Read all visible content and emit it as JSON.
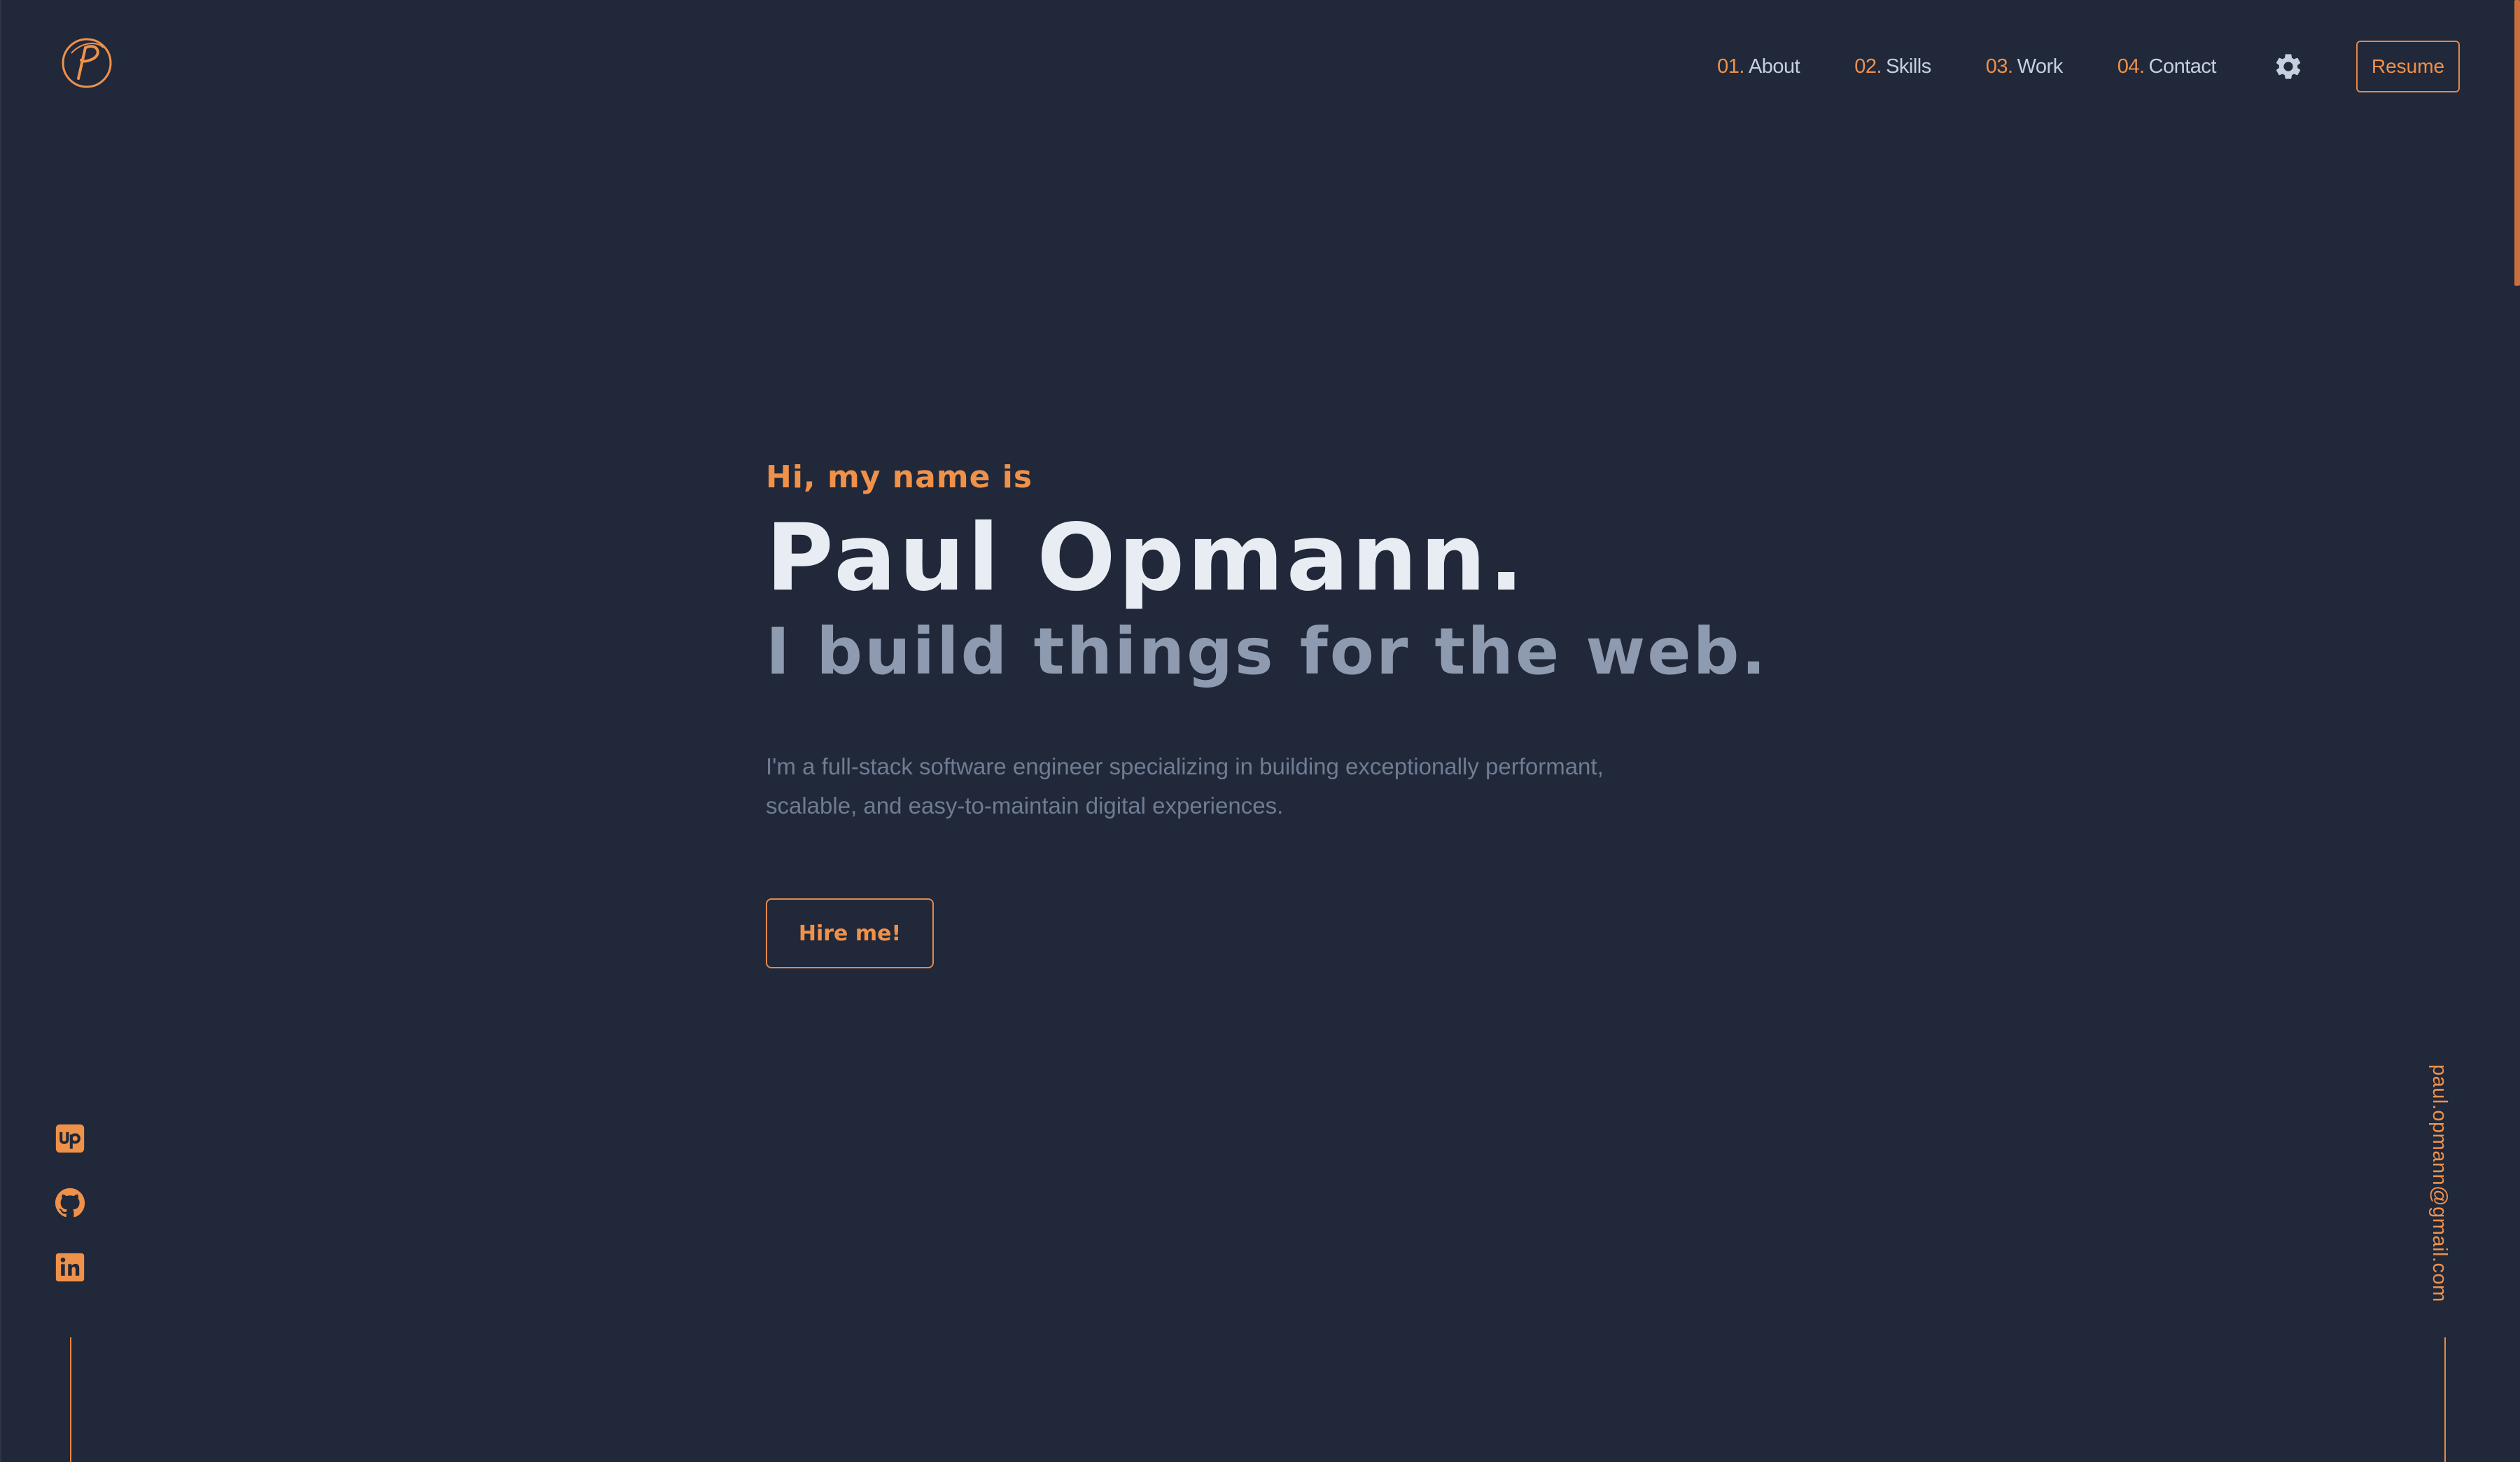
{
  "header": {
    "logo_icon": "p-monogram-logo",
    "nav": [
      {
        "num": "01.",
        "label": "About"
      },
      {
        "num": "02.",
        "label": "Skills"
      },
      {
        "num": "03.",
        "label": "Work"
      },
      {
        "num": "04.",
        "label": "Contact"
      }
    ],
    "theme_icon": "gear-icon",
    "resume_label": "Resume"
  },
  "hero": {
    "greeting": "Hi, my name is",
    "name": "Paul Opmann.",
    "tagline": "I build things for the web.",
    "intro": "I'm a full-stack software engineer specializing in building exceptionally performant, scalable, and easy-to-maintain digital experiences.",
    "cta_label": "Hire me!"
  },
  "social": [
    {
      "icon": "upwork-icon"
    },
    {
      "icon": "github-icon"
    },
    {
      "icon": "linkedin-icon"
    }
  ],
  "email": "paul.opmann@gmail.com",
  "colors": {
    "background": "#202839",
    "accent": "#f0914a",
    "heading": "#e8ecf3",
    "subheading": "#8d9ab0",
    "body_text": "#6f7c93"
  }
}
